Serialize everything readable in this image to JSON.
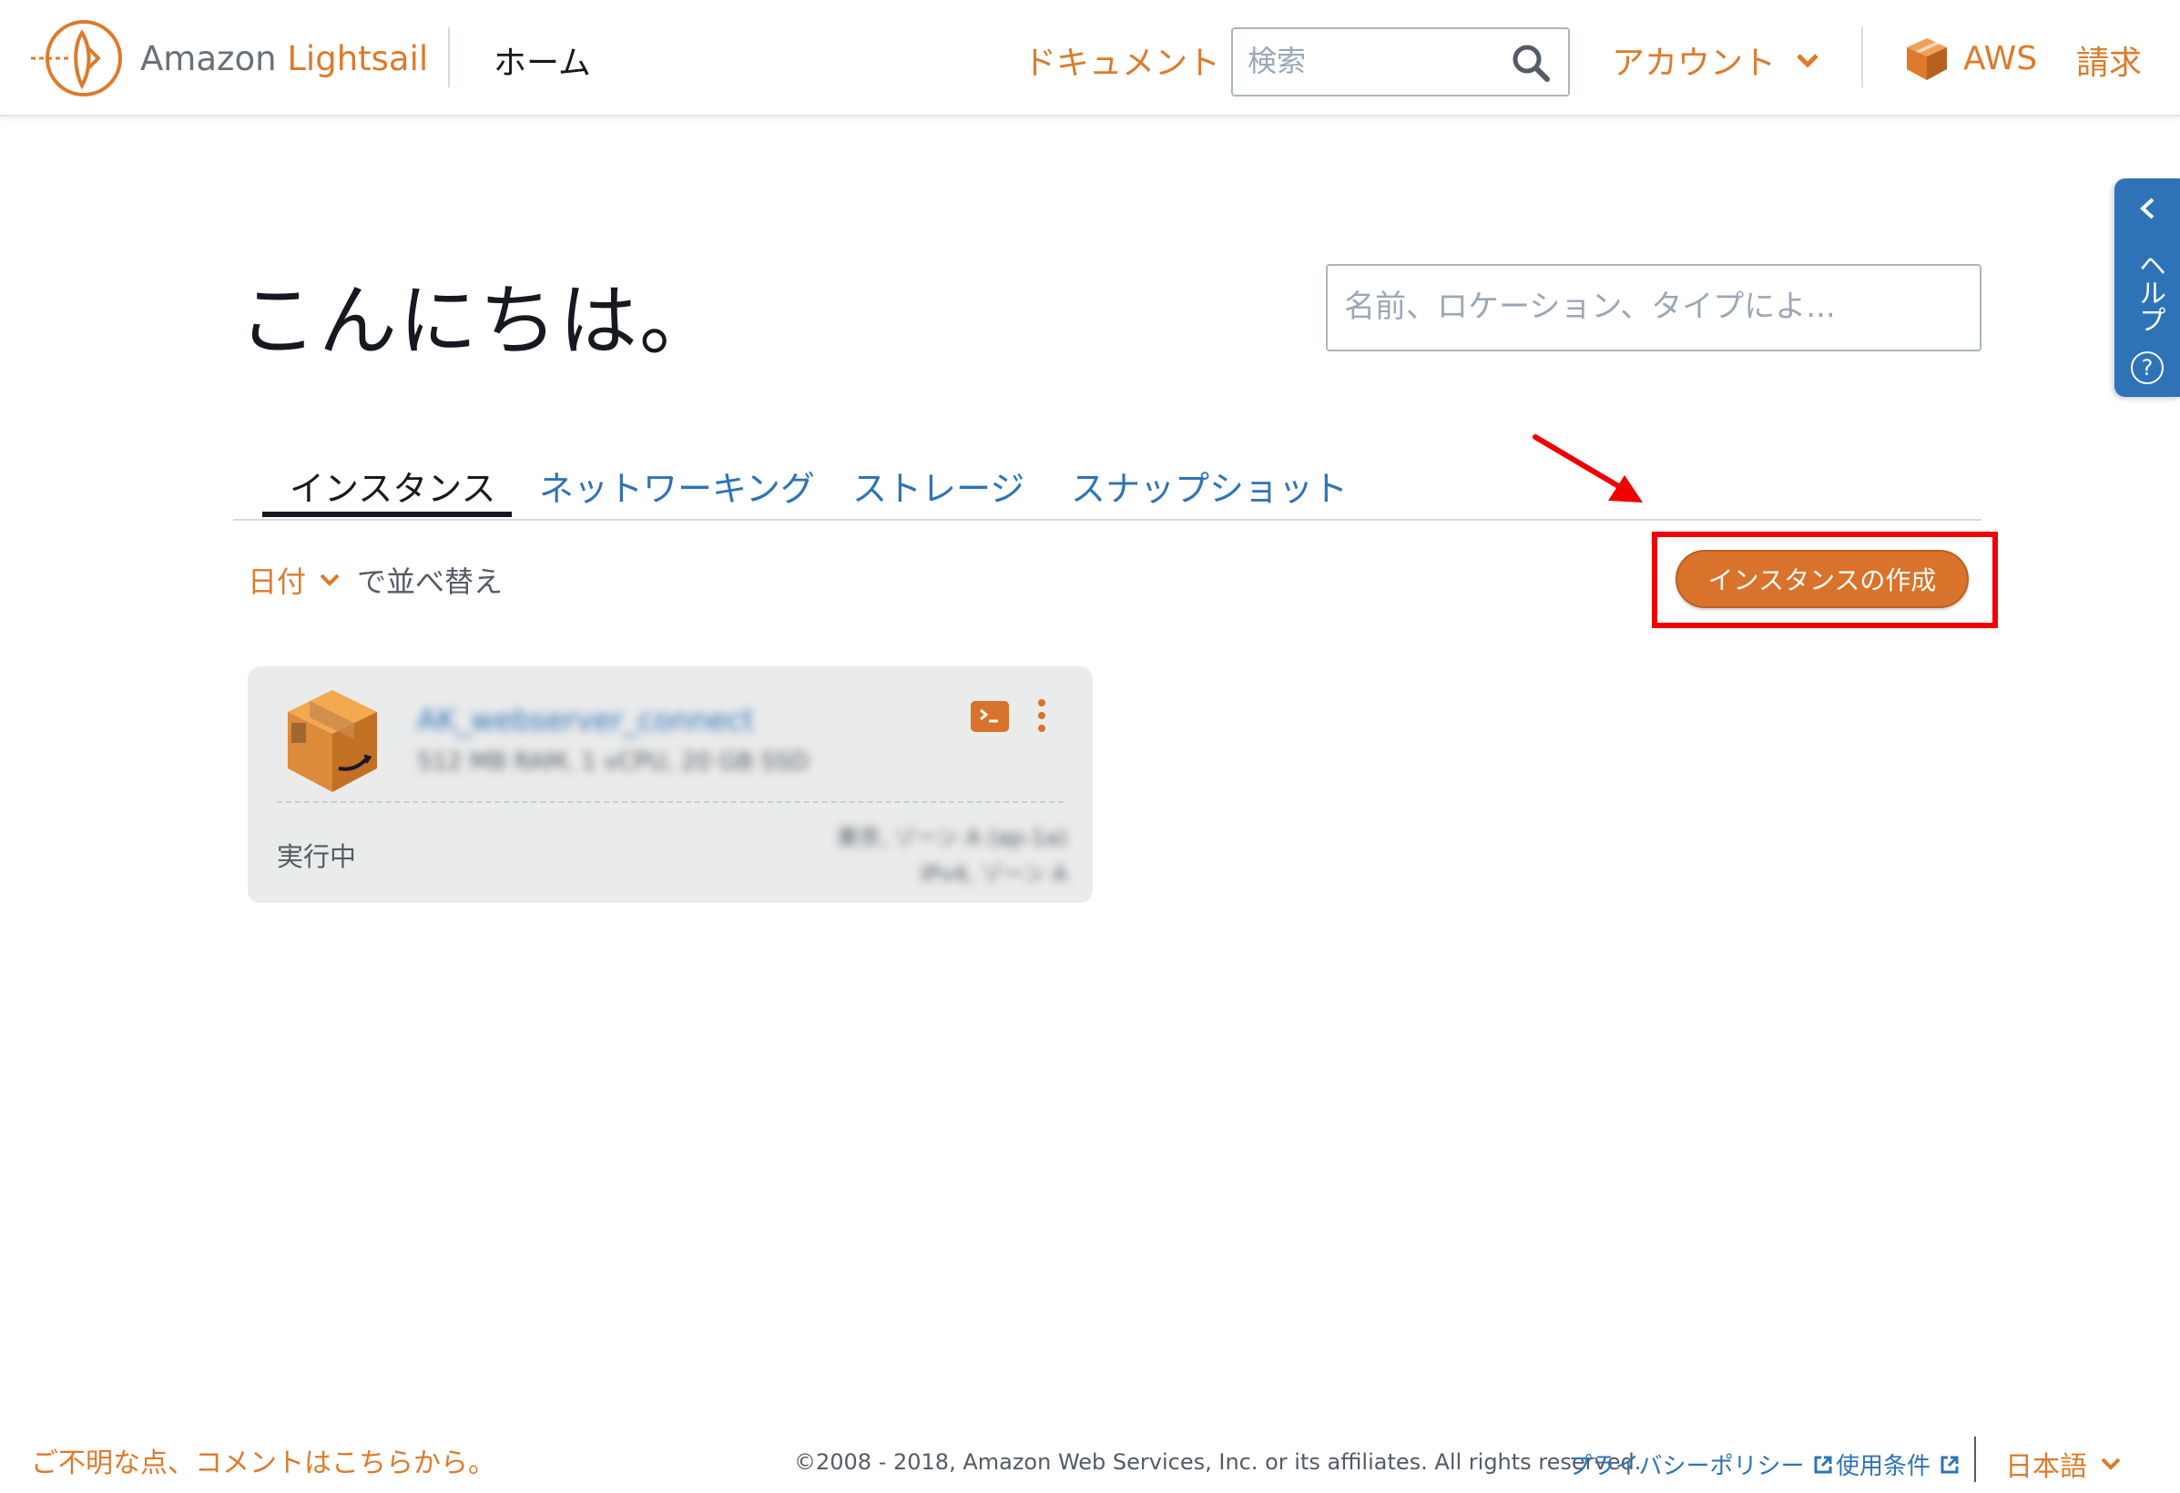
{
  "header": {
    "brand_prefix": "Amazon",
    "brand_name": "Lightsail",
    "home": "ホーム",
    "docs": "ドキュメント",
    "search_placeholder": "検索",
    "account": "アカウント",
    "aws": "AWS",
    "billing": "請求"
  },
  "help": {
    "label": "ヘルプ",
    "icon_char": "?"
  },
  "main": {
    "greeting": "こんにちは。",
    "filter_placeholder": "名前、ロケーション、タイプによ...",
    "tabs": [
      {
        "label": "インスタンス",
        "active": true
      },
      {
        "label": "ネットワーキング",
        "active": false
      },
      {
        "label": "ストレージ",
        "active": false
      },
      {
        "label": "スナップショット",
        "active": false
      }
    ],
    "sort_field": "日付",
    "sort_suffix": "で並べ替え",
    "create_button": "インスタンスの作成"
  },
  "instance": {
    "name": "AK_webserver_connect",
    "meta": "512 MB RAM, 1 vCPU, 20 GB SSD",
    "status": "実行中",
    "region_line1": "東京, ゾーン A (ap-1a)",
    "region_line2": "IPv4, ゾーン A"
  },
  "footer": {
    "feedback": "ご不明な点、コメントはこちらから。",
    "copyright": "©2008 - 2018, Amazon Web Services, Inc. or its affiliates. All rights reserved.",
    "privacy": "プライバシーポリシー",
    "terms": "使用条件",
    "language": "日本語"
  },
  "colors": {
    "accent_orange": "#dd7a2b",
    "link_blue": "#2e73b8",
    "highlight_red": "#f00000"
  }
}
